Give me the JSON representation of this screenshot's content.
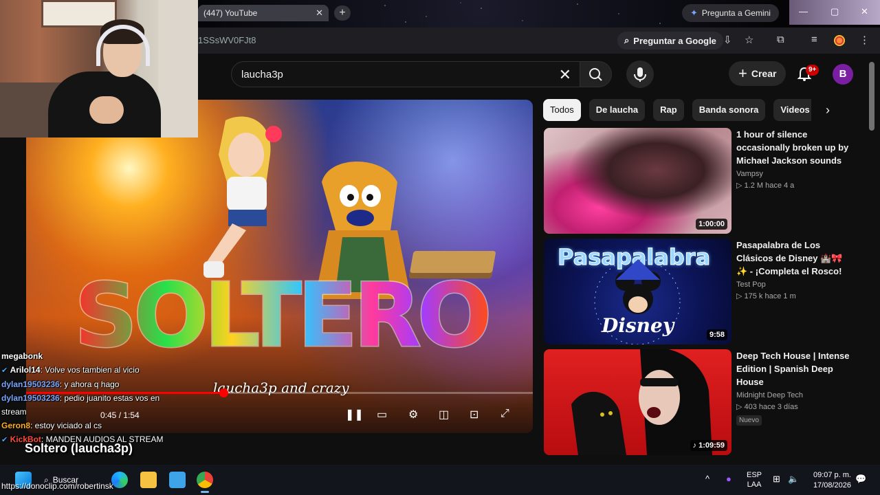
{
  "browser": {
    "tab_title": "(447) YouTube",
    "url_fragment": "1SSsWV0FJt8",
    "gemini_label": "Pregunta a Gemini",
    "ask_google_label": "Preguntar a Google"
  },
  "youtube": {
    "search_value": "laucha3p",
    "create_label": "Crear",
    "notifications_badge": "9+",
    "avatar_letter": "B",
    "chips": [
      "Todos",
      "De laucha",
      "Rap",
      "Banda sonora",
      "Videos re"
    ],
    "recommended": [
      {
        "title": "1 hour of silence occasionally broken up by Michael Jackson sounds",
        "channel": "Vampsy",
        "stats": "▷ 1.2 M  hace 4 a",
        "duration": "1:00:00",
        "tag": ""
      },
      {
        "title": "Pasapalabra de Los Clásicos de Disney 🏰🎀 ✨ - ¡Completa el Rosco!",
        "channel": "Test Pop",
        "stats": "▷ 175 k  hace 1 m",
        "duration": "9:58",
        "tag": "",
        "thumb_text": "Pasapalabra",
        "thumb_brand": "Disney"
      },
      {
        "title": "Deep Tech House | Intense Edition | Spanish Deep House",
        "channel": "Midnight Deep Tech",
        "stats": "▷ 403  hace 3 días",
        "duration": "♪ 1:09:59",
        "tag": "Nuevo"
      }
    ]
  },
  "player": {
    "logo_text": "SOLTERO",
    "subtitle": "laucha3p and crazy",
    "timecode": "0:45 / 1:54",
    "progress_fraction": 0.39,
    "video_title": "Soltero (laucha3p)"
  },
  "chat": {
    "messages": [
      {
        "user": "megabonk",
        "text": "",
        "color": "plain"
      },
      {
        "user": "Arilol14",
        "text": ": Volve vos tambien al vicio",
        "color": "plain",
        "verified": true
      },
      {
        "user": "dylan19503236",
        "text": ": y ahora q hago",
        "color": "blue"
      },
      {
        "user": "dylan19503236",
        "text": ": pedio juanito estas vos en stream",
        "color": "blue"
      },
      {
        "user": "Geron8",
        "text": ": estoy viciado al cs",
        "color": "orange"
      },
      {
        "user": "KickBot",
        "text": ": MANDEN AUDIOS AL STREAM",
        "color": "red",
        "verified": true
      }
    ],
    "donation_link": "https://donoclip.com/robertinsk"
  },
  "taskbar": {
    "search_label": "Buscar",
    "lang_line1": "ESP",
    "lang_line2": "LAA",
    "time": "09:07 p. m.",
    "date": "17/08/2026"
  }
}
